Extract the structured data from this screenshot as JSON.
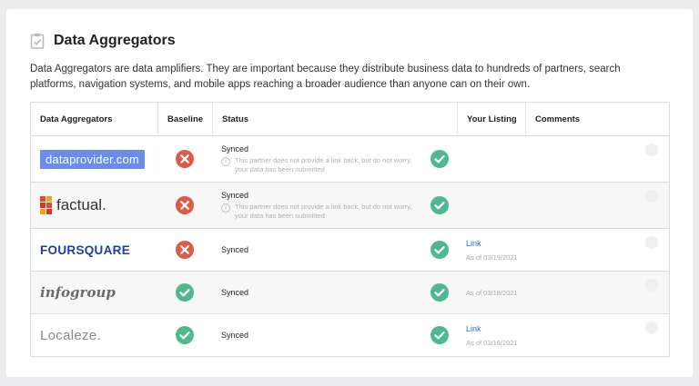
{
  "section": {
    "title": "Data Aggregators",
    "description": "Data Aggregators are data amplifiers. They are important because they distribute business data to hundreds of partners, search platforms, navigation systems, and mobile apps reaching a broader audience than anyone can on their own.",
    "icon": "clipboard-check-icon"
  },
  "table": {
    "headers": {
      "aggregators": "Data Aggregators",
      "baseline": "Baseline",
      "status": "Status",
      "listing": "Your Listing",
      "comments": "Comments"
    },
    "rows": [
      {
        "logo": "dataprovider.com",
        "baseline": "error",
        "status": "Synced",
        "note": "This partner does not provide a link back, but do not worry, your data has been submitted",
        "listing_link": "",
        "listing_date": ""
      },
      {
        "logo": "factual.",
        "baseline": "error",
        "status": "Synced",
        "note": "This partner does not provide a link back, but do not worry, your data has been submitted",
        "listing_link": "",
        "listing_date": ""
      },
      {
        "logo": "FOURSQUARE",
        "baseline": "error",
        "status": "Synced",
        "note": "",
        "listing_link": "Link",
        "listing_date": "As of 03/19/2021"
      },
      {
        "logo": "infogroup",
        "baseline": "success",
        "status": "Synced",
        "note": "",
        "listing_link": "",
        "listing_date": "As of 03/18/2021"
      },
      {
        "logo": "Localeze.",
        "baseline": "success",
        "status": "Synced",
        "note": "",
        "listing_link": "Link",
        "listing_date": "As of 03/18/2021"
      }
    ]
  },
  "colors": {
    "success": "#4fb88f",
    "error": "#db5a48",
    "link": "#2a6ad6",
    "dataprovider_bg": "#6b8de8",
    "foursquare": "#1b3fa3"
  }
}
